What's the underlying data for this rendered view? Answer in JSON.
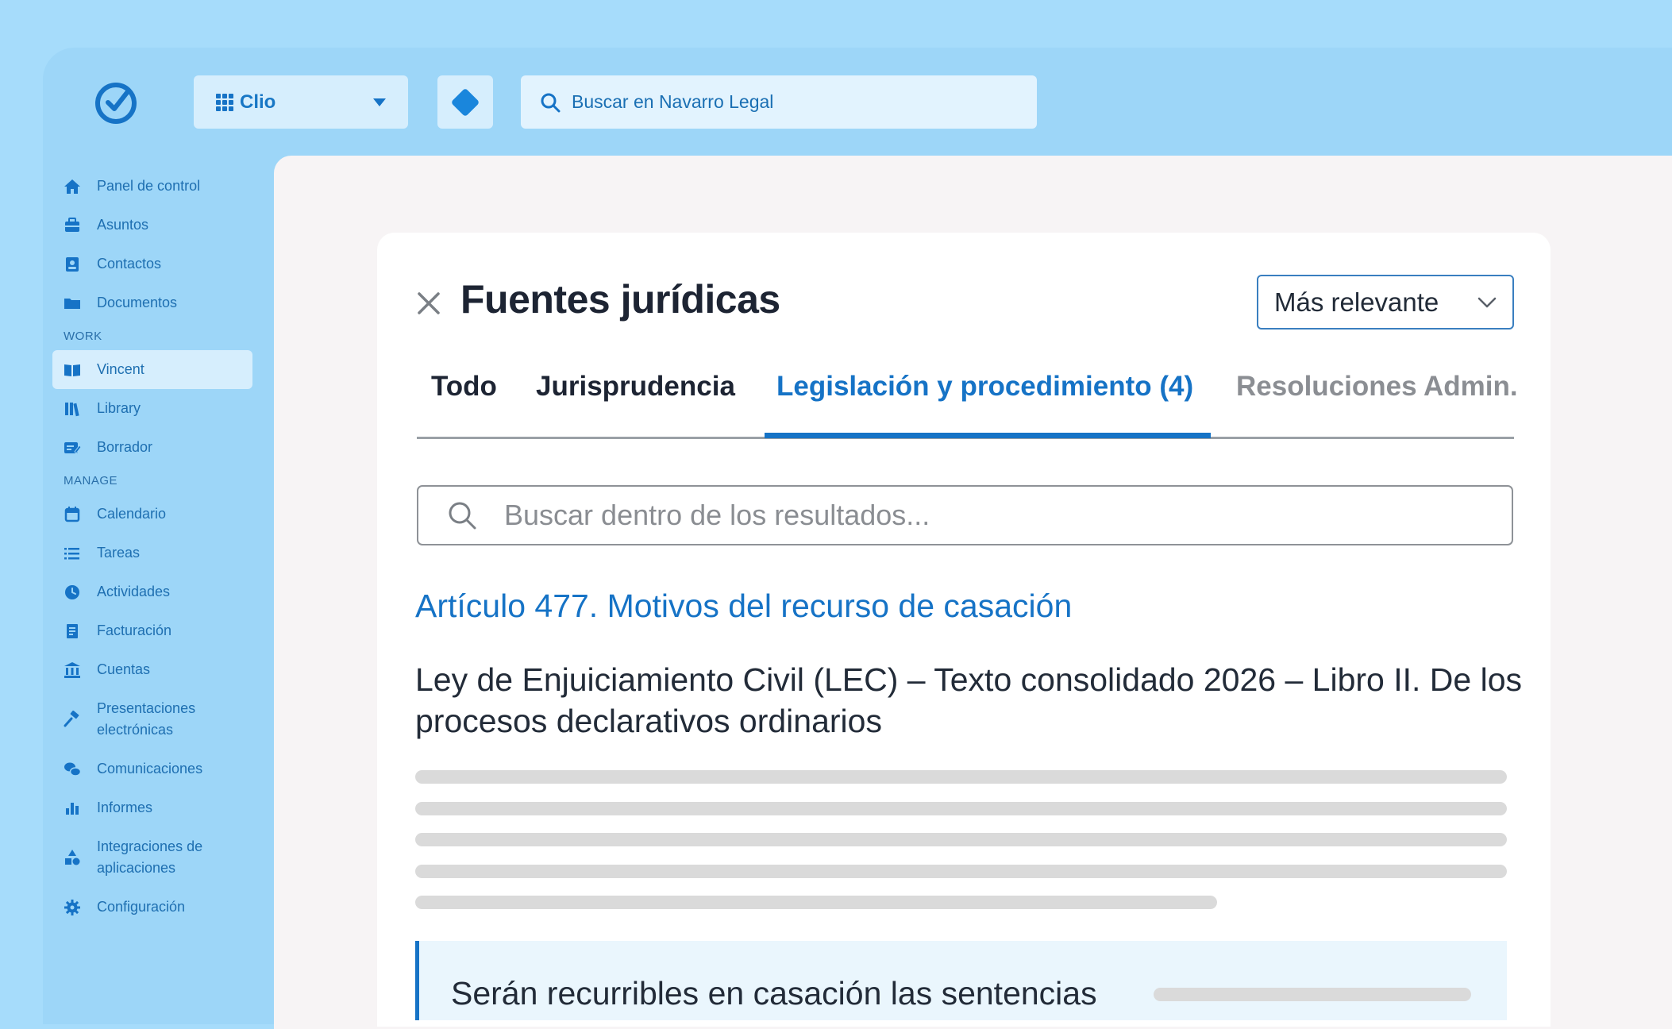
{
  "header": {
    "app_name": "Clio",
    "search_placeholder": "Buscar en Navarro Legal"
  },
  "sidebar": {
    "items_top": [
      {
        "label": "Panel de control",
        "icon": "home-icon"
      },
      {
        "label": "Asuntos",
        "icon": "briefcase-icon"
      },
      {
        "label": "Contactos",
        "icon": "contact-card-icon"
      },
      {
        "label": "Documentos",
        "icon": "folder-icon"
      }
    ],
    "section_work": "WORK",
    "items_work": [
      {
        "label": "Vincent",
        "icon": "book-open-icon"
      },
      {
        "label": "Library",
        "icon": "books-icon"
      },
      {
        "label": "Borrador",
        "icon": "draft-icon"
      }
    ],
    "section_manage": "MANAGE",
    "items_manage": [
      {
        "label": "Calendario",
        "icon": "calendar-icon"
      },
      {
        "label": "Tareas",
        "icon": "list-icon"
      },
      {
        "label": "Actividades",
        "icon": "clock-icon"
      },
      {
        "label": "Facturación",
        "icon": "invoice-icon"
      },
      {
        "label": "Cuentas",
        "icon": "bank-icon"
      },
      {
        "label": "Presentaciones electrónicas",
        "icon": "gavel-icon"
      },
      {
        "label": "Comunicaciones",
        "icon": "chat-icon"
      },
      {
        "label": "Informes",
        "icon": "bar-chart-icon"
      },
      {
        "label": "Integraciones de aplicaciones",
        "icon": "shapes-icon"
      },
      {
        "label": "Configuración",
        "icon": "gear-icon"
      }
    ]
  },
  "panel": {
    "title": "Fuentes jurídicas",
    "sort_value": "Más relevante",
    "tabs": [
      "Todo",
      "Jurisprudencia",
      "Legislación y procedimiento (4)",
      "Resoluciones Admin."
    ],
    "active_tab": "Legislación y procedimiento (4)",
    "search_placeholder": "Buscar dentro de los resultados...",
    "result": {
      "title": "Artículo 477. Motivos del recurso de casación",
      "source": "Ley de Enjuiciamiento Civil (LEC) – Texto consolidado 2026 – Libro II. De los procesos declarativos ordinarios",
      "quote": "Serán recurribles en casación las sentencias"
    }
  },
  "colors": {
    "background": "#a6dcfb",
    "accent": "#1673c6",
    "sidebar_text": "#1e6fb1"
  }
}
